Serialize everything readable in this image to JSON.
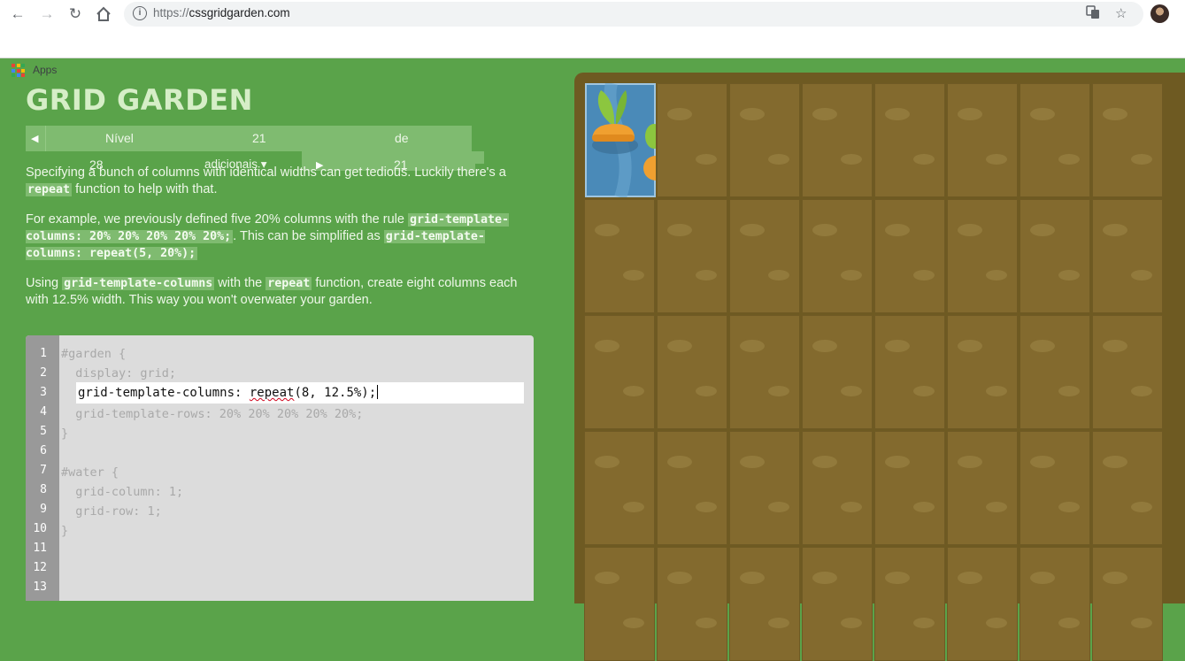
{
  "browser": {
    "url_scheme": "https://",
    "url_host": "cssgridgarden.com",
    "bookmarks": [
      {
        "label": "Apps"
      }
    ]
  },
  "page": {
    "title": "GRID GARDEN",
    "level": {
      "prev_arrow": "◀",
      "label_word": "Nível",
      "current": "21",
      "of_word": "de",
      "total": "28",
      "extra_label": "adicionais ▾",
      "next_arrow": "▶",
      "extra_count": "21"
    },
    "instructions": {
      "p1_a": "Specifying a bunch of columns with identical widths can get tedious. Luckily there's a ",
      "p1_code": "repeat",
      "p1_b": " function to help with that.",
      "p2_a": "For example, we previously defined five 20% columns with the rule ",
      "p2_code1": "grid-template-columns: 20% 20% 20% 20% 20%;",
      "p2_b": ". This can be simplified as ",
      "p2_code2": "grid-template-columns: repeat(5, 20%);",
      "p3_a": "Using ",
      "p3_code1": "grid-template-columns",
      "p3_b": " with the ",
      "p3_code2": "repeat",
      "p3_c": " function, create eight columns each with 12.5% width. This way you won't overwater your garden."
    },
    "editor": {
      "line_numbers": [
        "1",
        "2",
        "3",
        "4",
        "5",
        "6",
        "7",
        "8",
        "9",
        "10",
        "11",
        "12",
        "13"
      ],
      "line1": "#garden {",
      "line2": "  display: grid;",
      "input_prop": "grid-template-columns: ",
      "input_fn": "repeat",
      "input_args": "(8, 12.5%);",
      "line4": "  grid-template-rows: 20% 20% 20% 20% 20%;",
      "line5": "}",
      "line7": "#water {",
      "line8": "  grid-column: 1;",
      "line9": "  grid-row: 1;",
      "line10": "}"
    }
  },
  "colors": {
    "page_bg": "#5aa34a",
    "title": "#d6eec7",
    "code_highlight": "#7fbb70",
    "garden_border": "#6e5a22",
    "soil": "#836a2e",
    "water": "#4a8ab8",
    "carrot": "#f0a030",
    "leaf": "#8cc63f"
  }
}
